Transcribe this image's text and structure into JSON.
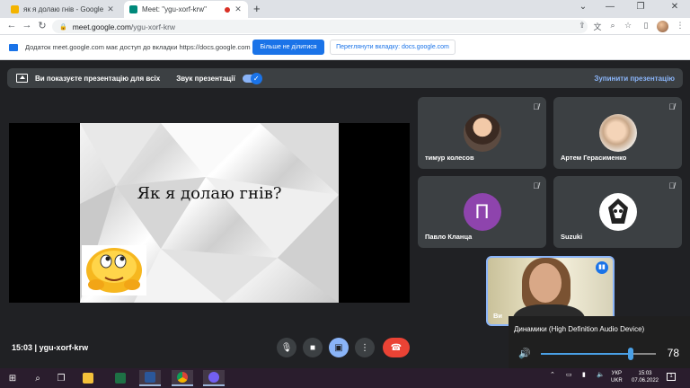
{
  "browser": {
    "tabs": [
      {
        "title": "як я долаю гнів - Google Пр",
        "favicon_color": "#f4b400"
      },
      {
        "title": "Meet: \"ygu-xorf-krw\"",
        "favicon_color": "#00897b"
      }
    ],
    "url": {
      "host": "meet.google.com",
      "path": "/ygu-xorf-krw"
    }
  },
  "sharebar": {
    "message": "Додаток meet.google.com має доступ до вкладки https://docs.google.com",
    "stop_sharing_label": "Більше не ділитися",
    "view_tab_label": "Переглянути вкладку: docs.google.com"
  },
  "presentation_bar": {
    "presenting_label": "Ви показуєте презентацію для всіх",
    "sound_label": "Звук презентації",
    "stop_label": "Зупинити презентацію"
  },
  "slide": {
    "title": "Як я долаю гнів?"
  },
  "participants": [
    {
      "name": "тимур колесов",
      "avatar": "photo"
    },
    {
      "name": "Артем Герасименко",
      "avatar": "photo"
    },
    {
      "name": "Павло Кланца",
      "avatar": "letter",
      "letter": "П",
      "color": "#8e44ad"
    },
    {
      "name": "Suzuki",
      "avatar": "logo"
    }
  ],
  "self_view": {
    "name": "Ви"
  },
  "meeting": {
    "time": "15:03",
    "code": "ygu-xorf-krw"
  },
  "volume_popup": {
    "device": "Динамики (High Definition Audio Device)",
    "level": 78
  },
  "taskbar": {
    "lang": [
      "УКР",
      "UKR"
    ],
    "time": "15:03",
    "date": "07.06.2022",
    "notifications": "1"
  },
  "colors": {
    "meet_bg": "#202124",
    "tile_bg": "#3c4043",
    "accent": "#1a73e8",
    "hangup": "#ea4335"
  }
}
